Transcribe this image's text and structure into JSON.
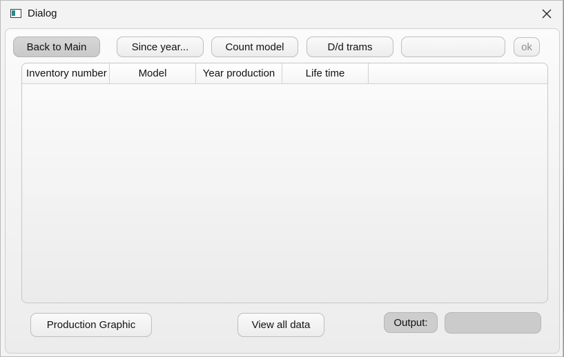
{
  "window": {
    "title": "Dialog"
  },
  "toolbar": {
    "back_label": "Back to Main",
    "since_year_label": "Since year...",
    "count_model_label": "Count model",
    "dd_trams_label": "D/d trams",
    "input_value": "",
    "ok_label": "ok"
  },
  "table": {
    "columns": [
      "Inventory number",
      "Model",
      "Year production",
      "Life time"
    ],
    "rows": []
  },
  "footer": {
    "production_graphic_label": "Production Graphic",
    "view_all_label": "View all data",
    "output_label": "Output:",
    "output_value": ""
  }
}
